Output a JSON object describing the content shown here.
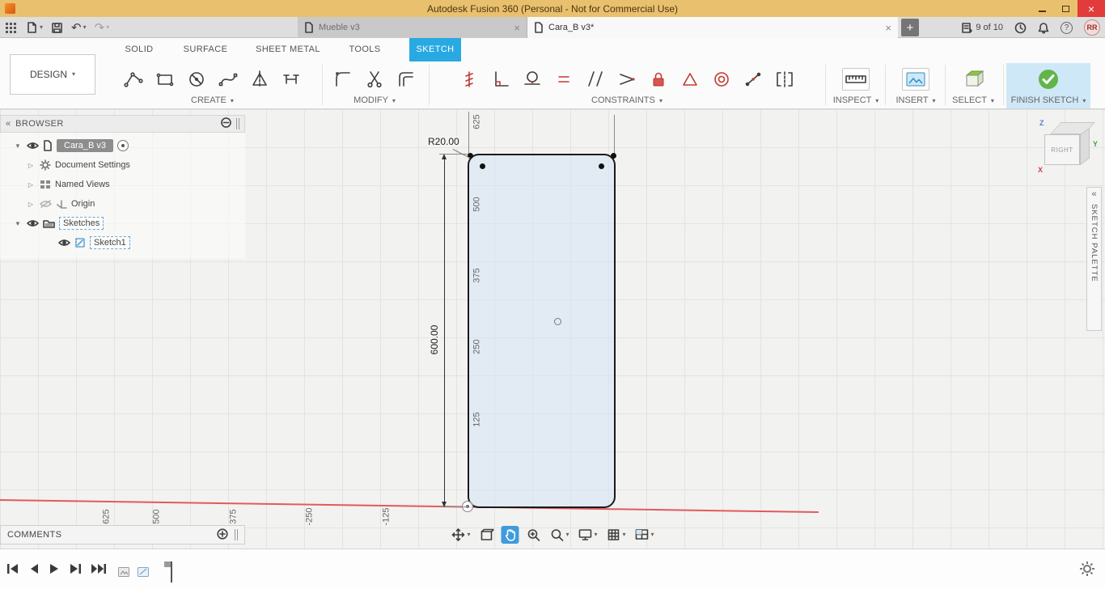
{
  "window": {
    "title": "Autodesk Fusion 360 (Personal - Not for Commercial Use)",
    "close_glyph": "×"
  },
  "icons": {
    "caret": "▾",
    "collapse": "«",
    "expand_open": "▼",
    "expand_closed": "▷",
    "undo": "↶",
    "redo": "↷"
  },
  "quickbar": {
    "doc_tabs": [
      {
        "label": "Mueble v3"
      },
      {
        "label": "Cara_B v3*"
      }
    ],
    "tab_close": "×",
    "add_tab": "+",
    "job_status": "9 of 10",
    "help": "?",
    "avatar": "RR"
  },
  "ribbon": {
    "design_button": "DESIGN",
    "tabs": [
      "SOLID",
      "SURFACE",
      "SHEET METAL",
      "TOOLS",
      "SKETCH"
    ],
    "groups": {
      "create": "CREATE",
      "modify": "MODIFY",
      "constraints": "CONSTRAINTS",
      "inspect": "INSPECT",
      "insert": "INSERT",
      "select": "SELECT",
      "finish": "FINISH SKETCH"
    }
  },
  "browser": {
    "header": "BROWSER",
    "items": [
      {
        "label": "Cara_B v3"
      },
      {
        "label": "Document Settings"
      },
      {
        "label": "Named Views"
      },
      {
        "label": "Origin"
      },
      {
        "label": "Sketches"
      },
      {
        "label": "Sketch1"
      }
    ]
  },
  "canvas": {
    "dimension": "600.00",
    "radius": "R20.00",
    "y_ticks": [
      "625",
      "500",
      "375",
      "250",
      "125"
    ],
    "x_ticks": [
      "625",
      "500",
      "375",
      "-250",
      "-125"
    ],
    "viewcube": {
      "face": "RIGHT",
      "z": "Z",
      "y": "Y",
      "x": "X"
    }
  },
  "panels": {
    "sketch_palette": "SKETCH PALETTE",
    "comments": "COMMENTS"
  },
  "colors": {
    "titlebar": "#e9c06e",
    "accent_blue": "#29a9e1",
    "finish_green": "#61b54b",
    "axis_red": "#e15b5b"
  }
}
